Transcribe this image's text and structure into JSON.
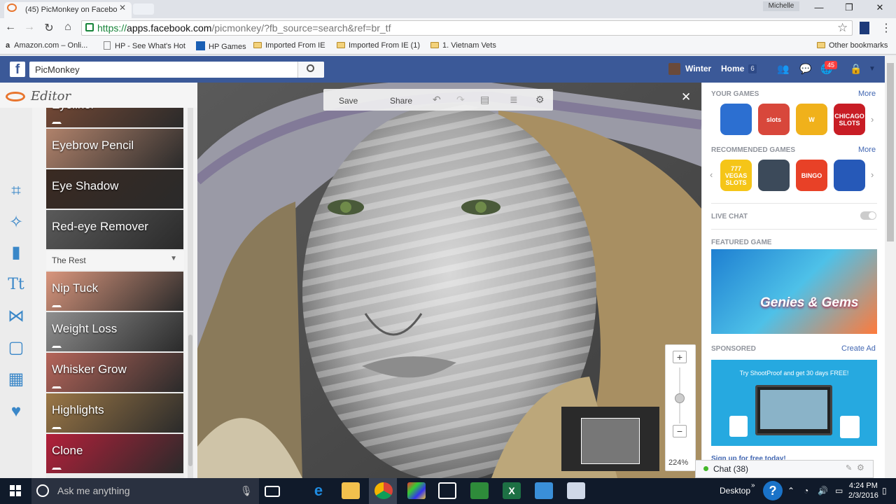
{
  "browser": {
    "tab_title": "(45) PicMonkey on Facebo",
    "user_name": "Michelle",
    "url_scheme": "https://",
    "url_host": "apps.facebook.com",
    "url_path": "/picmonkey/?fb_source=search&ref=br_tf",
    "bookmarks": [
      "Amazon.com – Onli...",
      "HP - See What's Hot",
      "HP Games",
      "Imported From IE",
      "Imported From IE (1)",
      "1. Vietnam Vets"
    ],
    "other_bookmarks": "Other bookmarks"
  },
  "facebook": {
    "logo": "f",
    "search_value": "PicMonkey",
    "user": "Winter",
    "home": "Home",
    "home_count": "6",
    "notifications_count": "45"
  },
  "editor": {
    "logo": "Editor",
    "effects_top": [
      {
        "label": "Eyeliner",
        "color": "#7a4b36"
      },
      {
        "label": "Eyebrow Pencil",
        "color": "#b0826b"
      },
      {
        "label": "Eye Shadow",
        "color": "#3a2a22"
      },
      {
        "label": "Red-eye Remover",
        "color": "#5a5a5a"
      }
    ],
    "section_label": "The Rest",
    "effects_rest": [
      {
        "label": "Nip Tuck",
        "color": "#d9967d"
      },
      {
        "label": "Weight Loss",
        "color": "#8f8f8f"
      },
      {
        "label": "Whisker Grow",
        "color": "#b5655a"
      },
      {
        "label": "Highlights",
        "color": "#9b7746"
      },
      {
        "label": "Clone",
        "color": "#b3203a"
      }
    ],
    "tool_icons": [
      "crop-icon",
      "magic-wand-icon",
      "lipstick-icon",
      "text-icon",
      "butterfly-icon",
      "frame-icon",
      "texture-icon",
      "heart-icon"
    ]
  },
  "photo_toolbar": {
    "save": "Save",
    "share": "Share"
  },
  "zoom": {
    "plus": "+",
    "minus": "−",
    "level": "224%",
    "slider_fraction": 0.55
  },
  "right_column": {
    "your_games": "YOUR GAMES",
    "more": "More",
    "recommended_games": "RECOMMENDED GAMES",
    "live_chat": "LIVE CHAT",
    "featured_game": "FEATURED GAME",
    "featured_title": "Genies & Gems",
    "sponsored": "SPONSORED",
    "create_ad": "Create Ad",
    "ad_text": "Try ShootProof and get 30 days FREE!",
    "ad_signup": "Sign up for free today!",
    "chat": "Chat (38)",
    "your_games_tiles": [
      "#2c6fd1",
      "#d8473b",
      "#f0b11b",
      "#c81d25"
    ],
    "your_games_labels": [
      "",
      "slots",
      "W",
      "CHICAGO SLOTS"
    ],
    "recommended_tiles": [
      "#f5c518",
      "#3c4a5a",
      "#e84127",
      "#2659b8"
    ],
    "recommended_labels": [
      "777 VEGAS SLOTS",
      "",
      "BINGO",
      ""
    ]
  },
  "taskbar": {
    "search_placeholder": "Ask me anything",
    "desktop": "Desktop",
    "time": "4:24 PM",
    "date": "2/3/2016"
  }
}
